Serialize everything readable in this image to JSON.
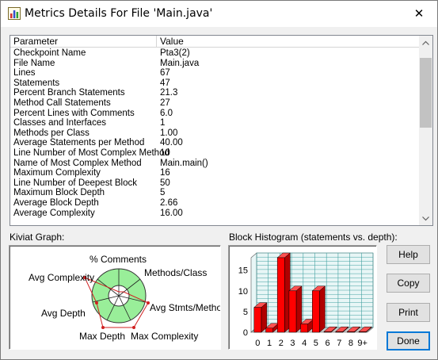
{
  "window": {
    "title": "Metrics Details For File 'Main.java'",
    "close_glyph": "✕",
    "app_icon": "bar-chart-icon"
  },
  "metrics_table": {
    "columns": [
      "Parameter",
      "Value"
    ],
    "rows": [
      [
        "Checkpoint Name",
        "Pta3(2)"
      ],
      [
        "File Name",
        "Main.java"
      ],
      [
        "Lines",
        "67"
      ],
      [
        "Statements",
        "47"
      ],
      [
        "Percent Branch Statements",
        "21.3"
      ],
      [
        "Method Call Statements",
        "27"
      ],
      [
        "Percent Lines with Comments",
        "6.0"
      ],
      [
        "Classes and Interfaces",
        "1"
      ],
      [
        "Methods per Class",
        "1.00"
      ],
      [
        "Average Statements per Method",
        "40.00"
      ],
      [
        "Line Number of Most Complex Method",
        "10"
      ],
      [
        "Name of Most Complex Method",
        "Main.main()"
      ],
      [
        "Maximum Complexity",
        "16"
      ],
      [
        "Line Number of Deepest Block",
        "50"
      ],
      [
        "Maximum Block Depth",
        "5"
      ],
      [
        "Average Block Depth",
        "2.66"
      ],
      [
        "Average Complexity",
        "16.00"
      ]
    ]
  },
  "kiviat": {
    "label": "Kiviat Graph:",
    "axes": [
      "% Comments",
      "Methods/Class",
      "Avg Stmts/Method",
      "Max Complexity",
      "Max Depth",
      "Avg Depth",
      "Avg Complexity"
    ]
  },
  "histogram": {
    "label": "Block Histogram (statements vs. depth):"
  },
  "chart_data": {
    "type": "bar",
    "categories": [
      "0",
      "1",
      "2",
      "3",
      "4",
      "5",
      "6",
      "7",
      "8",
      "9+"
    ],
    "values": [
      6,
      1,
      18,
      10,
      2,
      10,
      0,
      0,
      0,
      0
    ],
    "yticks": [
      "0",
      "5",
      "10",
      "15"
    ],
    "ylim": [
      0,
      18
    ],
    "color": "#ff0000",
    "grid": true
  },
  "buttons": {
    "help": "Help",
    "copy": "Copy",
    "print": "Print",
    "done": "Done"
  },
  "colors": {
    "bar": "#ff0000",
    "kiviat_ring": "#99ee99",
    "kiviat_polygon": "#d02020"
  }
}
